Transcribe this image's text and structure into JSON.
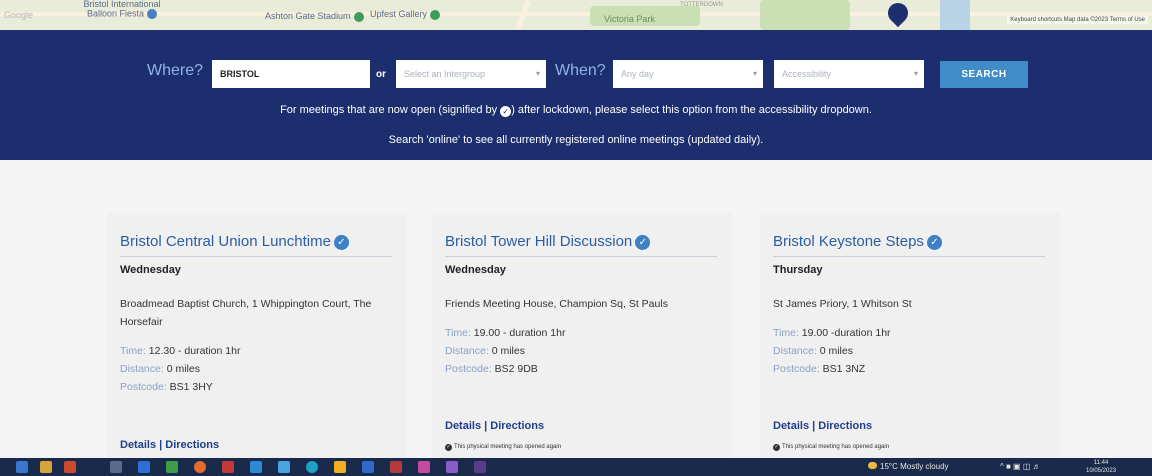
{
  "map": {
    "google_logo": "Google",
    "labels": {
      "balloon": "Bristol International Balloon Fiesta",
      "stadium": "Ashton Gate Stadium",
      "gallery": "Upfest Gallery",
      "park": "Victoria Park",
      "area": "TOTTERDOWN"
    },
    "attribution": "Keyboard shortcuts   Map data ©2023   Terms of Use"
  },
  "search": {
    "where_label": "Where?",
    "where_value": "BRISTOL",
    "or_label": "or",
    "intergroup_placeholder": "Select an Intergroup",
    "when_label": "When?",
    "day_placeholder": "Any day",
    "accessibility_placeholder": "Accessibility",
    "search_button": "SEARCH",
    "info_1_before": "For meetings that are now open (signified by",
    "info_1_after": ") after lockdown, please select this option from the accessibility dropdown.",
    "info_2": "Search 'online' to see all currently registered online meetings (updated daily)."
  },
  "labels": {
    "time": "Time:",
    "distance": "Distance:",
    "postcode": "Postcode:",
    "details": "Details",
    "separator": "|",
    "directions": "Directions",
    "opened_note": "This physical meeting has opened again"
  },
  "meetings": [
    {
      "title": "Bristol Central Union Lunchtime",
      "day": "Wednesday",
      "address": "Broadmead Baptist Church, 1 Whippington Court, The Horsefair",
      "time": "12.30 - duration 1hr",
      "distance": "0 miles",
      "postcode": "BS1 3HY"
    },
    {
      "title": "Bristol Tower Hill Discussion",
      "day": "Wednesday",
      "address": "Friends Meeting House, Champion Sq, St Pauls",
      "time": "19.00 - duration 1hr",
      "distance": "0 miles",
      "postcode": "BS2 9DB"
    },
    {
      "title": "Bristol Keystone Steps",
      "day": "Thursday",
      "address": "St James Priory, 1 Whitson St",
      "time": "19.00 -duration 1hr",
      "distance": "0 miles",
      "postcode": "BS1 3NZ"
    }
  ],
  "taskbar": {
    "weather": "15°C  Mostly cloudy",
    "time": "11:44",
    "date": "10/05/2023"
  },
  "colors": {
    "band": "#1c2e6e",
    "accent": "#3f8cc9",
    "title": "#2a5ea3"
  }
}
